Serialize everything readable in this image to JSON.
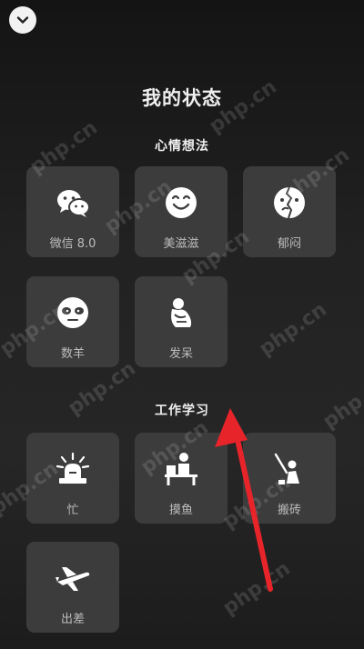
{
  "header": {
    "title": "我的状态"
  },
  "sections": [
    {
      "title": "心情想法",
      "items": [
        {
          "label": "微信 8.0",
          "icon": "wechat-icon"
        },
        {
          "label": "美滋滋",
          "icon": "smile-icon"
        },
        {
          "label": "郁闷",
          "icon": "upset-face-icon"
        },
        {
          "label": "数羊",
          "icon": "sheep-face-icon"
        },
        {
          "label": "发呆",
          "icon": "daydream-icon"
        }
      ]
    },
    {
      "title": "工作学习",
      "items": [
        {
          "label": "忙",
          "icon": "busy-alarm-icon"
        },
        {
          "label": "摸鱼",
          "icon": "slacking-desk-icon"
        },
        {
          "label": "搬砖",
          "icon": "laborer-icon"
        },
        {
          "label": "出差",
          "icon": "airplane-icon"
        }
      ]
    }
  ],
  "watermark": "php.cn",
  "colors": {
    "background": "#1e1e1e",
    "tile": "#3c3c3c",
    "arrow": "#e8242b"
  }
}
